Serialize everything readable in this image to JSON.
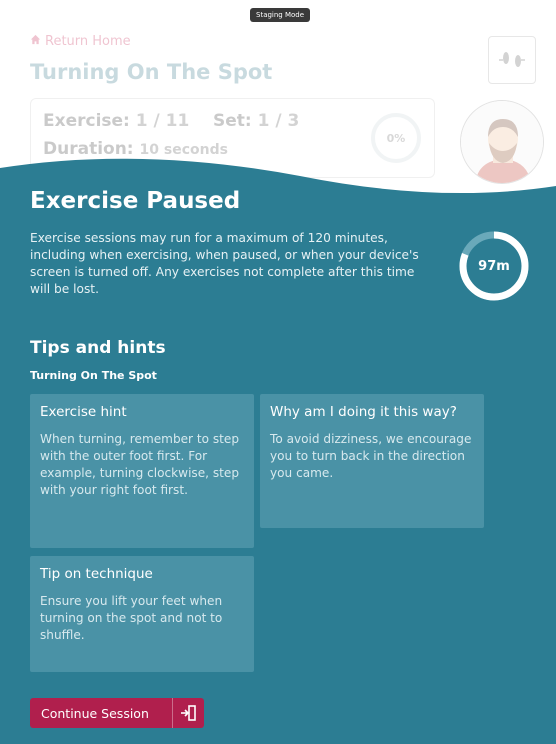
{
  "staging": {
    "label": "Staging Mode"
  },
  "header": {
    "return_home": "Return Home",
    "title": "Turning On The Spot"
  },
  "stats": {
    "exercise_label": "Exercise:",
    "exercise_value": "1 / 11",
    "set_label": "Set:",
    "set_value": "1 / 3",
    "duration_label": "Duration:",
    "duration_value": "10 seconds",
    "progress_percent": "0%"
  },
  "paused": {
    "title": "Exercise Paused",
    "message": "Exercise sessions may run for a maximum of 120 minutes, including when exercising, when paused, or when your device's screen is turned off. Any exercises not complete after this time will be lost.",
    "timer_label": "97m",
    "timer_fraction": 0.81
  },
  "tips": {
    "heading": "Tips and hints",
    "exercise_name": "Turning On The Spot",
    "cards": [
      {
        "title": "Exercise hint",
        "body": "When turning, remember to step with the outer foot first. For example, turning clockwise, step with your right foot first."
      },
      {
        "title": "Why am I doing it this way?",
        "body": "To avoid dizziness, we encourage you to turn back in the direction you came."
      },
      {
        "title": "Tip on technique",
        "body": "Ensure you lift your feet when turning on the spot and not to shuffle."
      }
    ]
  },
  "actions": {
    "continue_label": "Continue Session"
  },
  "colors": {
    "panel_teal": "#2c7d93",
    "card_teal": "#4a92a6",
    "accent_crimson": "#b01f4d",
    "title_teal": "#3e7e8f"
  },
  "icons": {
    "home": "home-icon",
    "feet": "feet-icon",
    "exit": "exit-door-icon"
  }
}
